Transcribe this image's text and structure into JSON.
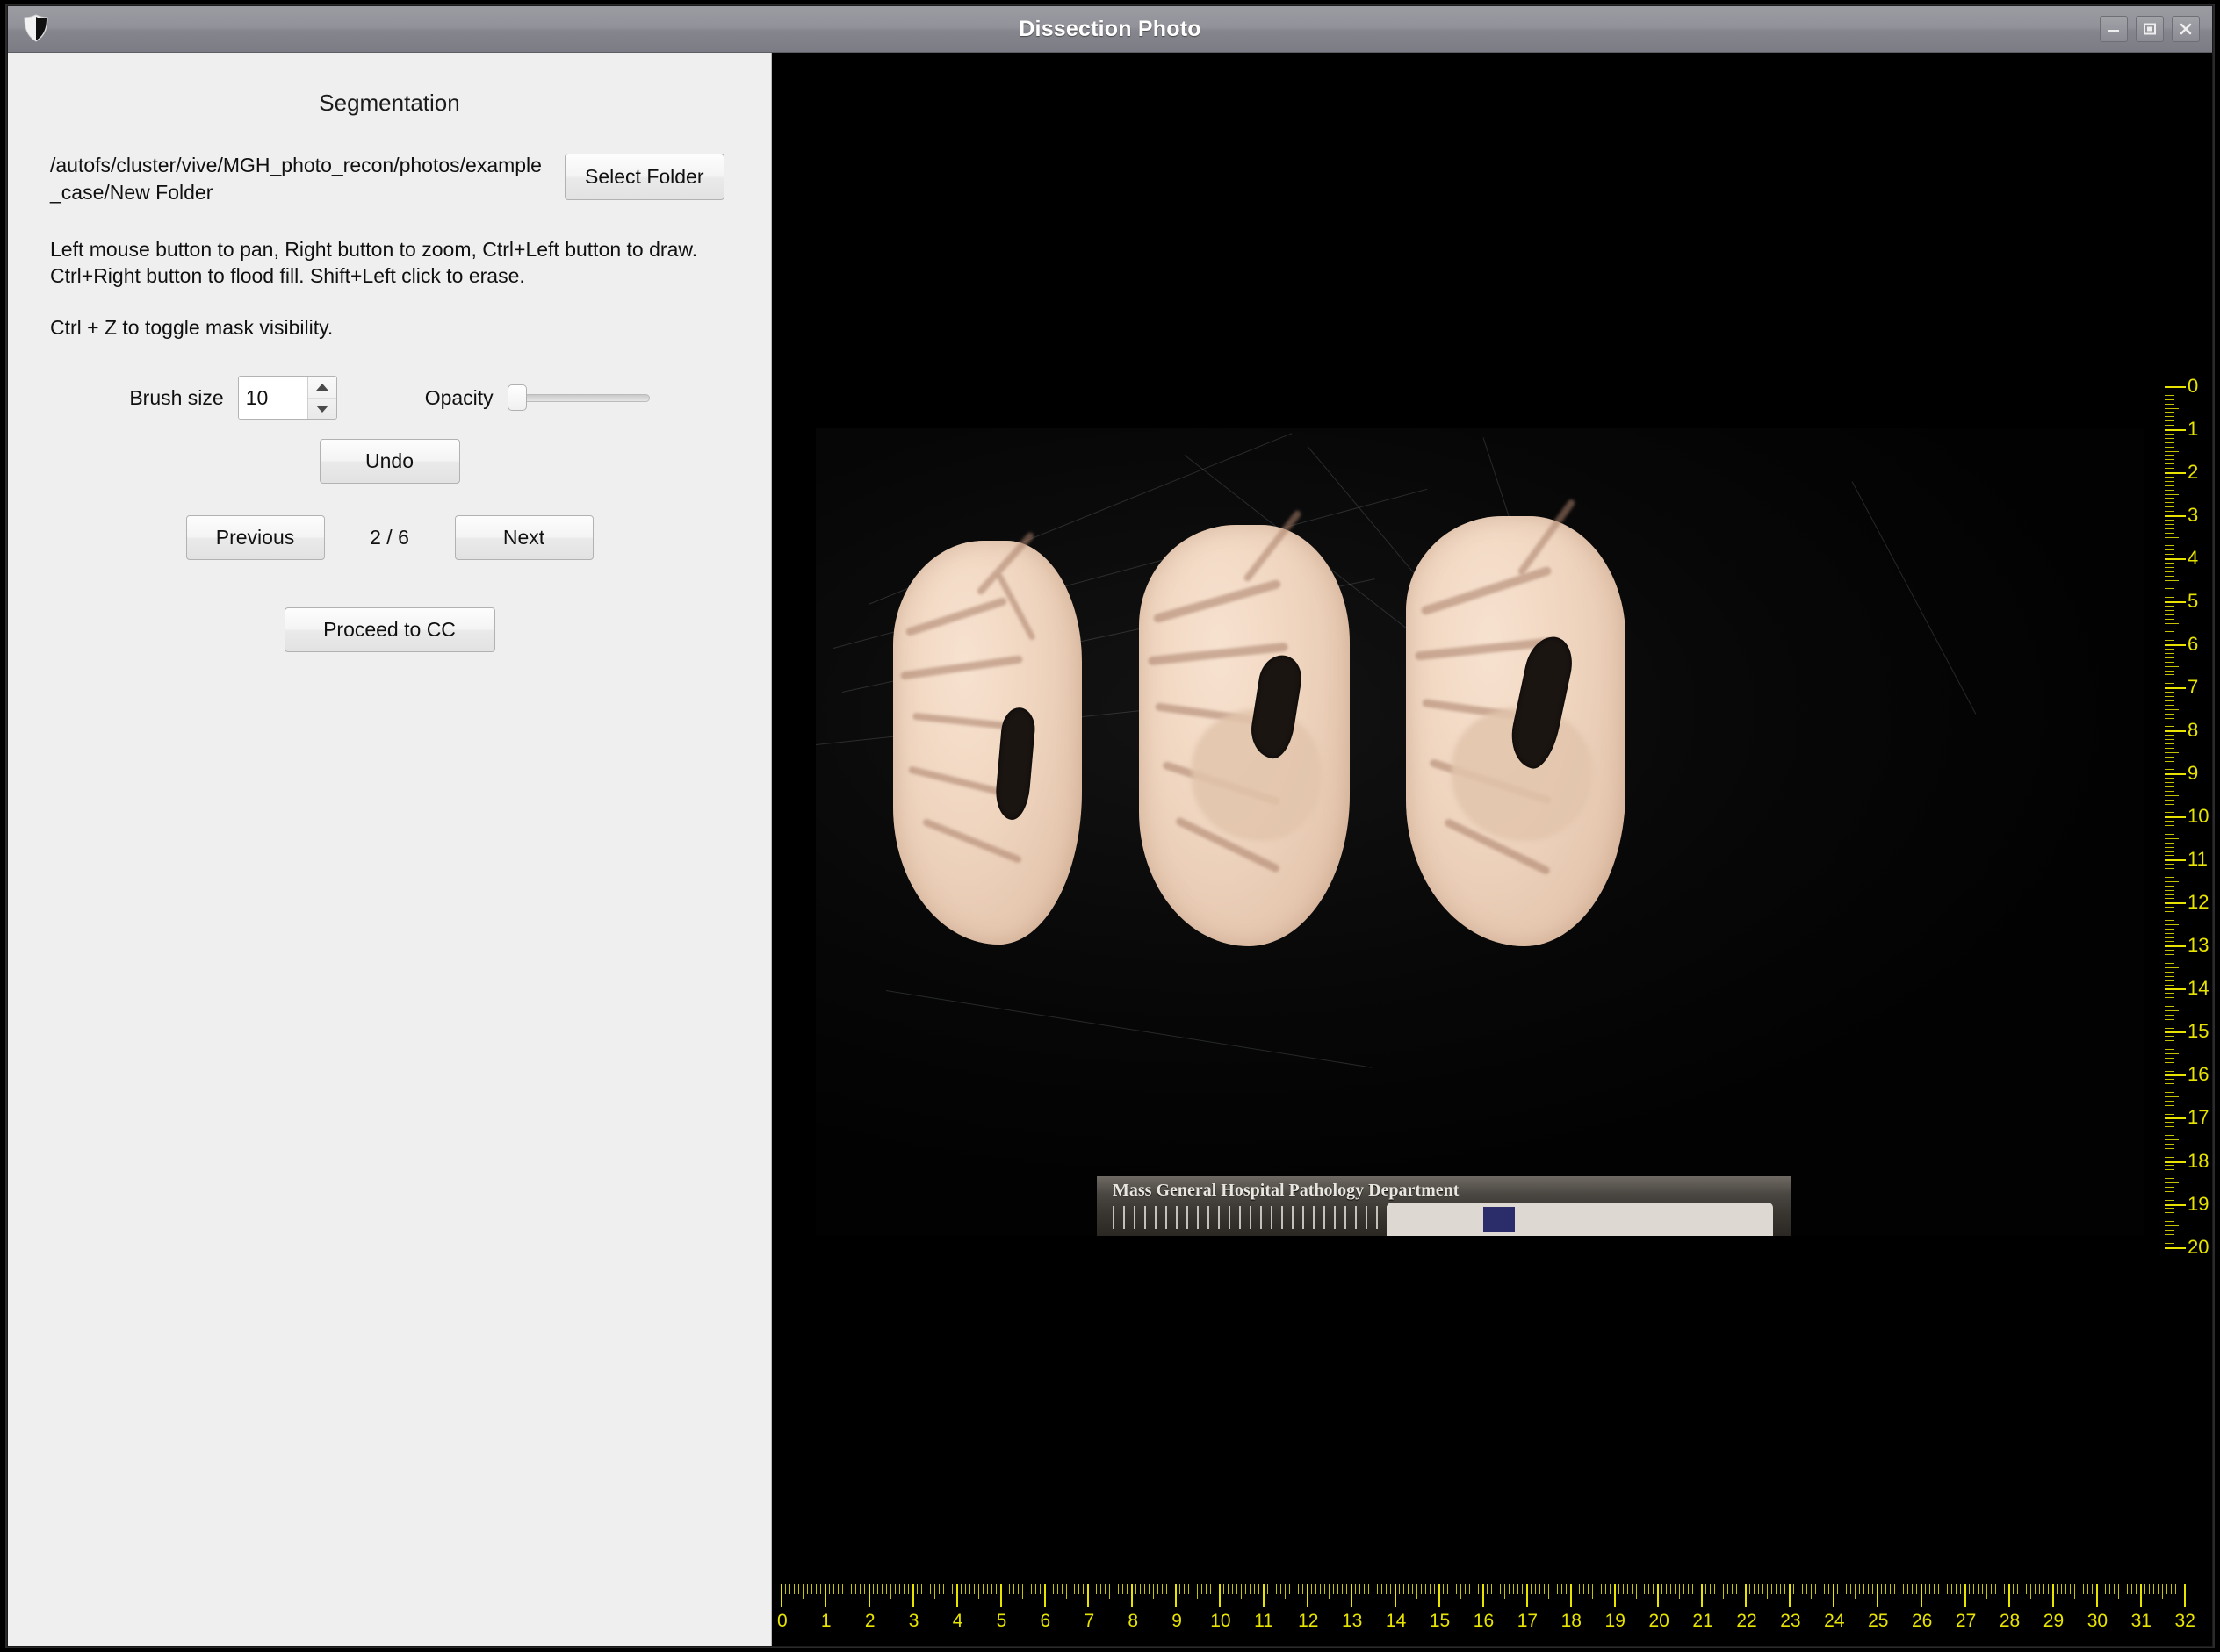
{
  "window": {
    "title": "Dissection Photo",
    "icon": "shield-icon",
    "controls": {
      "minimize": "minimize-icon",
      "maximize": "maximize-icon",
      "close": "close-icon"
    }
  },
  "panel": {
    "heading": "Segmentation",
    "folder_path": "/autofs/cluster/vive/MGH_photo_recon/photos/example_case/New Folder",
    "select_folder_label": "Select Folder",
    "instructions_line1": "Left mouse button to pan, Right button to zoom, Ctrl+Left button to draw. Ctrl+Right button to flood fill. Shift+Left click to erase.",
    "instructions_line2": "Ctrl + Z to toggle mask visibility.",
    "brush_size_label": "Brush size",
    "brush_size_value": "10",
    "opacity_label": "Opacity",
    "opacity_value": "0",
    "undo_label": "Undo",
    "previous_label": "Previous",
    "next_label": "Next",
    "page_indicator": "2 / 6",
    "proceed_label": "Proceed to CC"
  },
  "viewer": {
    "photo_caption": "Mass General Hospital Pathology Department",
    "background_color": "#000000",
    "ruler_color": "#e8e400",
    "ruler_horizontal": {
      "unit_labels": [
        "0",
        "1",
        "2",
        "3",
        "4",
        "5",
        "6",
        "7",
        "8",
        "9",
        "10",
        "11",
        "12",
        "13",
        "14",
        "15",
        "16",
        "17",
        "18",
        "19",
        "20",
        "21",
        "22",
        "23",
        "24",
        "25",
        "26",
        "27",
        "28",
        "29",
        "30",
        "31",
        "32"
      ]
    },
    "ruler_vertical": {
      "unit_labels": [
        "0",
        "1",
        "2",
        "3",
        "4",
        "5",
        "6",
        "7",
        "8",
        "9",
        "10",
        "11",
        "12",
        "13",
        "14",
        "15",
        "16",
        "17",
        "18",
        "19",
        "20"
      ]
    }
  }
}
